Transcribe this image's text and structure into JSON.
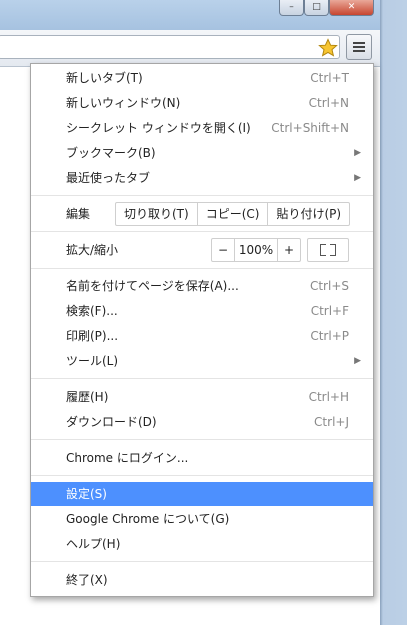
{
  "window": {
    "min_glyph": "–",
    "max_glyph": "□",
    "close_glyph": "✕"
  },
  "toolbar": {
    "bookmark_icon": "star-icon",
    "menu_icon": "hamburger-menu-icon",
    "star_color": "#f7c531"
  },
  "menu": {
    "new_tab": {
      "label": "新しいタブ(T)",
      "shortcut": "Ctrl+T"
    },
    "new_window": {
      "label": "新しいウィンドウ(N)",
      "shortcut": "Ctrl+N"
    },
    "incognito": {
      "label": "シークレット ウィンドウを開く(I)",
      "shortcut": "Ctrl+Shift+N"
    },
    "bookmarks": {
      "label": "ブックマーク(B)"
    },
    "recent_tabs": {
      "label": "最近使ったタブ"
    },
    "edit": {
      "label": "編集",
      "cut": "切り取り(T)",
      "copy": "コピー(C)",
      "paste": "貼り付け(P)"
    },
    "zoom": {
      "label": "拡大/縮小",
      "minus": "−",
      "value": "100%",
      "plus": "+"
    },
    "save_page": {
      "label": "名前を付けてページを保存(A)...",
      "shortcut": "Ctrl+S"
    },
    "find": {
      "label": "検索(F)...",
      "shortcut": "Ctrl+F"
    },
    "print": {
      "label": "印刷(P)...",
      "shortcut": "Ctrl+P"
    },
    "tools": {
      "label": "ツール(L)"
    },
    "history": {
      "label": "履歴(H)",
      "shortcut": "Ctrl+H"
    },
    "downloads": {
      "label": "ダウンロード(D)",
      "shortcut": "Ctrl+J"
    },
    "signin": {
      "label": "Chrome にログイン..."
    },
    "settings": {
      "label": "設定(S)"
    },
    "about": {
      "label": "Google Chrome について(G)"
    },
    "help": {
      "label": "ヘルプ(H)"
    },
    "exit": {
      "label": "終了(X)"
    },
    "selected_color": "#4d90fe"
  }
}
